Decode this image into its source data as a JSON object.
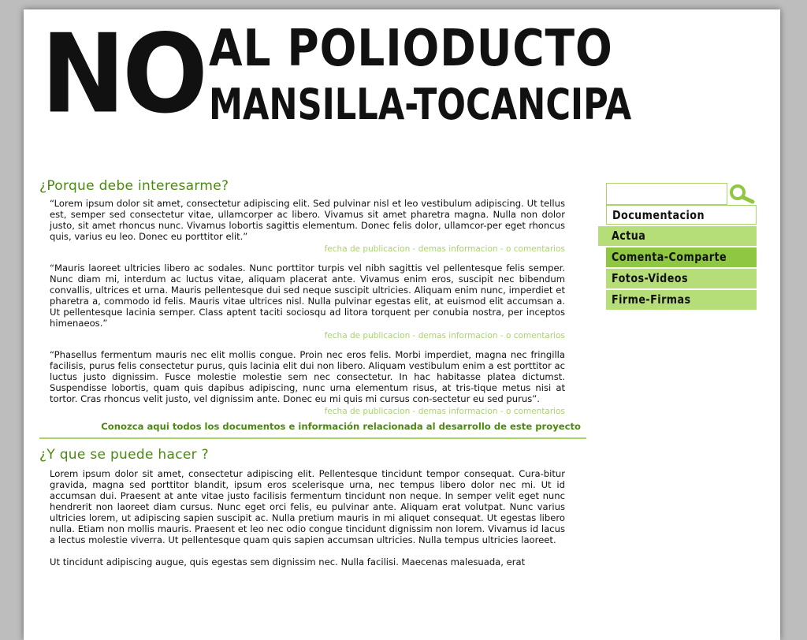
{
  "header": {
    "no": "NO",
    "line1": "AL POLIODUCTO",
    "line2": "MANSILLA-TOCANCIPA"
  },
  "search": {
    "placeholder": "",
    "icon": "search-icon"
  },
  "nav": {
    "items": [
      {
        "label": "Documentacion"
      },
      {
        "label": "Actua"
      },
      {
        "label": "Comenta-Comparte"
      },
      {
        "label": "Fotos-Videos"
      },
      {
        "label": "Firme-Firmas"
      }
    ]
  },
  "sections": [
    {
      "title": "¿Porque debe interesarme?",
      "posts": [
        {
          "text": "“Lorem ipsum dolor sit amet, consectetur adipiscing elit. Sed pulvinar nisl et leo vestibulum adipiscing. Ut tellus est, semper sed consectetur vitae, ullamcorper ac libero. Vivamus sit amet pharetra magna. Nulla non dolor justo, sit amet rhoncus nunc. Vivamus lobortis sagittis elementum. Donec felis dolor, ullamcor-per eget rhoncus quis, varius eu leo. Donec eu porttitor elit.”",
          "meta": "fecha de publicacion - demas informacion - o comentarios"
        },
        {
          "text": "“Mauris laoreet ultricies libero ac sodales. Nunc porttitor turpis vel nibh sagittis vel pellentesque felis semper. Nunc diam mi, interdum ac luctus vitae, aliquam placerat ante. Vivamus enim eros, suscipit nec bibendum convallis, ultrices et urna. Mauris pellentesque dui sed neque suscipit ultricies. Aliquam enim nunc, imperdiet et pharetra a, commodo id felis. Mauris vitae ultrices nisl. Nulla pulvinar egestas elit, at euismod elit accumsan a. Ut pellentesque lacinia semper. Class aptent taciti sociosqu ad litora torquent per conubia nostra, per inceptos himenaeos.”",
          "meta": "fecha de publicacion - demas informacion - o comentarios"
        },
        {
          "text": "“Phasellus fermentum mauris nec elit mollis congue. Proin nec eros felis. Morbi imperdiet, magna nec fringilla facilisis, purus felis consectetur purus, quis lacinia elit dui non libero. Aliquam vestibulum enim a est porttitor ac luctus justo dignissim. Fusce molestie molestie sem nec consectetur. In hac habitasse platea dictumst. Suspendisse lobortis, quam quis dapibus adipiscing, nunc urna elementum risus, at tris-tique metus nisi at tortor. Cras rhoncus velit justo, vel dignissim ante. Donec eu mi quis mi cursus con-sectetur eu sed purus”.",
          "meta": "fecha de publicacion - demas informacion - o comentarios"
        }
      ],
      "more_link": "Conozca aqui todos los documentos e información relacionada al desarrollo de este proyecto"
    },
    {
      "title": "¿Y que se puede hacer   ?",
      "paragraphs": [
        "Lorem ipsum dolor sit amet, consectetur adipiscing elit. Pellentesque tincidunt tempor consequat. Cura-bitur gravida, magna sed porttitor blandit, ipsum eros scelerisque urna, nec tempus libero dolor nec mi. Ut id accumsan dui. Praesent at ante vitae justo facilisis fermentum tincidunt non neque. In semper velit eget nunc hendrerit non laoreet diam cursus. Nunc eget orci felis, eu pulvinar ante. Aliquam erat volutpat. Nunc varius ultricies lorem, ut adipiscing sapien suscipit ac. Nulla pretium mauris in mi aliquet consequat. Ut egestas libero nulla. Etiam non mollis mauris. Praesent et leo nec odio congue tincidunt dignissim non lorem. Vivamus id lacus a lectus molestie viverra. Ut pellentesque quam quis sapien accumsan ultricies. Nulla tempus ultricies laoreet.",
        "Ut tincidunt adipiscing augue, quis egestas sem dignissim nec. Nulla facilisi. Maecenas malesuada, erat"
      ]
    }
  ],
  "colors": {
    "accent": "#4a8a0c",
    "light_green": "#b6de78",
    "active_green": "#8fc742",
    "meta_green": "#a8d468"
  }
}
